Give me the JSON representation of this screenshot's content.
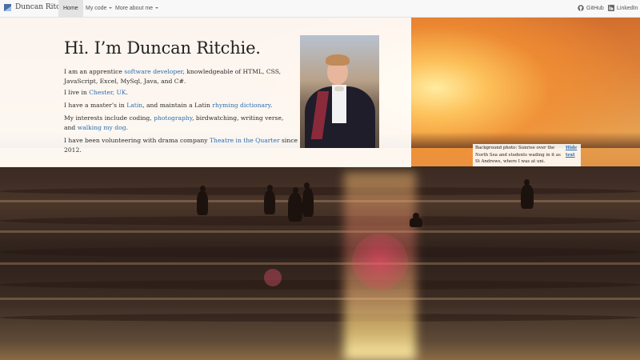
{
  "navbar": {
    "brand": "Duncan Ritchie",
    "items": [
      {
        "label": "Home",
        "active": true
      },
      {
        "label": "My code",
        "dropdown": true
      },
      {
        "label": "More about me",
        "dropdown": true
      }
    ],
    "right": [
      {
        "label": "GitHub",
        "icon": "github-icon"
      },
      {
        "label": "LinkedIn",
        "icon": "linkedin-icon"
      }
    ]
  },
  "intro": {
    "title": "Hi. I’m Duncan Ritchie.",
    "p1_a": "I am an apprentice ",
    "p1_link": "software developer",
    "p1_b": ", knowledgeable of HTML, CSS, JavaScript, Excel, MySql, Java, and C#.",
    "p2_a": "I live in ",
    "p2_link": "Chester, UK",
    "p2_b": ".",
    "p3_a": "I have a master’s in ",
    "p3_link1": "Latin",
    "p3_b": ", and maintain a Latin ",
    "p3_link2": "rhyming dictionary",
    "p3_c": ".",
    "p4_a": "My interests include coding, ",
    "p4_link1": "photography",
    "p4_b": ", birdwatching, writing verse, and ",
    "p4_link2": "walking my dog",
    "p4_c": ".",
    "p5_a": "I have been volunteering with drama company ",
    "p5_link": "Theatre in the Quarter",
    "p5_b": " since 2012."
  },
  "caption": {
    "text": "Background photo: Sunrise over the North Sea and students wading in it as St Andrews, where I was at uni.",
    "hide": "Hide text"
  },
  "colors": {
    "link": "#2a6fb1",
    "navbar_bg": "#f8f8f8",
    "panel_bg": "rgba(255,255,255,0.92)"
  }
}
